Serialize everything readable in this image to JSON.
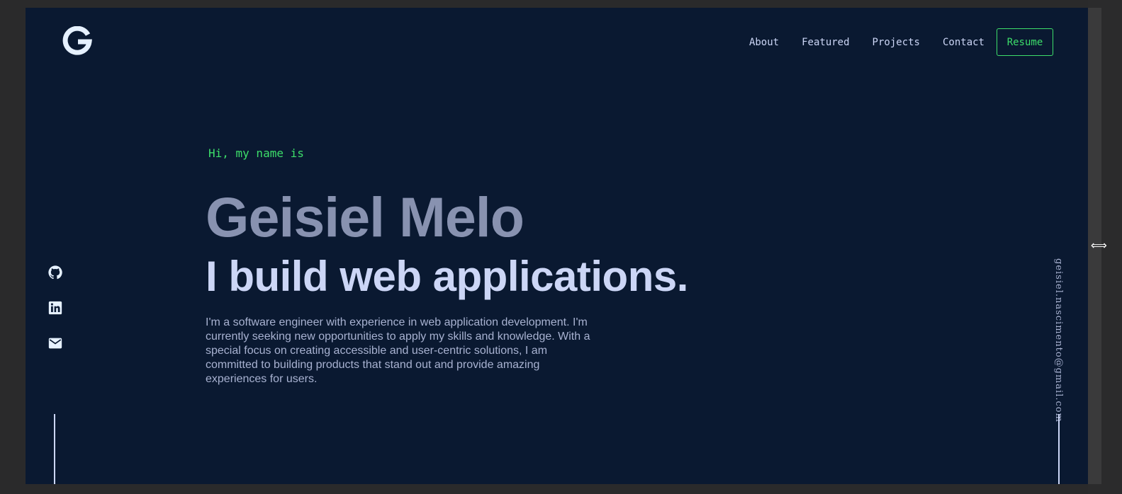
{
  "header": {
    "logo_letter": "G",
    "nav": [
      {
        "label": "About"
      },
      {
        "label": "Featured"
      },
      {
        "label": "Projects"
      },
      {
        "label": "Contact"
      }
    ],
    "resume_label": "Resume"
  },
  "hero": {
    "greeting": "Hi, my name is",
    "name": "Geisiel Melo",
    "tagline": "I build web applications.",
    "description": "I'm a software engineer with experience in web application development. I'm currently seeking new opportunities to apply my skills and knowledge. With a special focus on creating accessible and user-centric solutions, I am committed to building products that stand out and provide amazing experiences for users."
  },
  "social": {
    "icons": [
      "github-icon",
      "linkedin-icon",
      "mail-icon"
    ]
  },
  "email": "geisiel.nascimento@gmail.com",
  "colors": {
    "background": "#0a1931",
    "accent": "#3dde6a",
    "name": "#8892b0",
    "tagline": "#ccd6f6",
    "text": "#a8b2d1"
  }
}
